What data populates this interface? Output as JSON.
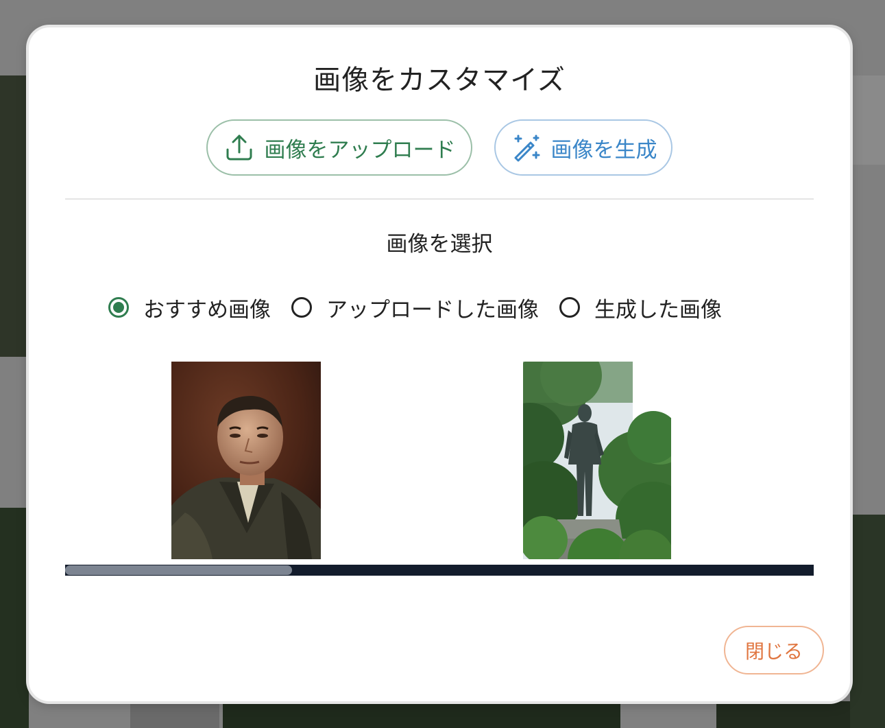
{
  "modal": {
    "title": "画像をカスタマイズ",
    "upload_button": "画像をアップロード",
    "generate_button": "画像を生成",
    "section_title": "画像を選択",
    "tabs": [
      {
        "label": "おすすめ画像",
        "selected": true
      },
      {
        "label": "アップロードした画像",
        "selected": false
      },
      {
        "label": "生成した画像",
        "selected": false
      }
    ],
    "close_button": "閉じる"
  },
  "icons": {
    "upload": "upload-icon",
    "generate": "magic-wand-icon"
  },
  "colors": {
    "green_accent": "#2f7d4f",
    "blue_accent": "#3a86c8",
    "orange_accent": "#e0753f",
    "scrollbar_track": "#131c2c"
  }
}
